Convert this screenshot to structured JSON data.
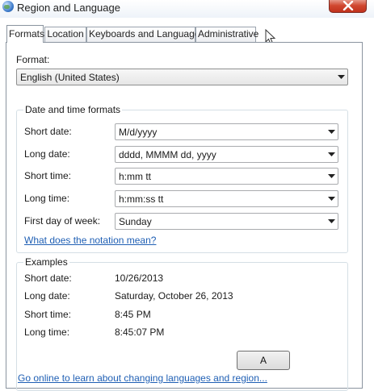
{
  "window": {
    "title": "Region and Language",
    "close_icon": "close-icon"
  },
  "tabs": [
    {
      "label": "Formats",
      "active": true
    },
    {
      "label": "Location",
      "active": false
    },
    {
      "label": "Keyboards and Languages",
      "active": false
    },
    {
      "label": "Administrative",
      "active": false
    }
  ],
  "format": {
    "label": "Format:",
    "value": "English (United States)"
  },
  "date_time": {
    "group_title": "Date and time formats",
    "fields": [
      {
        "label": "Short date:",
        "value": "M/d/yyyy"
      },
      {
        "label": "Long date:",
        "value": "dddd, MMMM dd, yyyy"
      },
      {
        "label": "Short time:",
        "value": "h:mm tt"
      },
      {
        "label": "Long time:",
        "value": "h:mm:ss tt"
      },
      {
        "label": "First day of week:",
        "value": "Sunday"
      }
    ],
    "notation_link": "What does the notation mean?"
  },
  "examples": {
    "group_title": "Examples",
    "rows": [
      {
        "label": "Short date:",
        "value": "10/26/2013"
      },
      {
        "label": "Long date:",
        "value": "Saturday, October 26, 2013"
      },
      {
        "label": "Short time:",
        "value": "8:45 PM"
      },
      {
        "label": "Long time:",
        "value": "8:45:07 PM"
      }
    ]
  },
  "buttons": {
    "ok_partial": "A"
  },
  "footer": {
    "link": "Go online to learn about changing languages and region..."
  },
  "colors": {
    "accent_link": "#1f5fb4",
    "close_button": "#c1321d",
    "border": "#8a949f"
  }
}
